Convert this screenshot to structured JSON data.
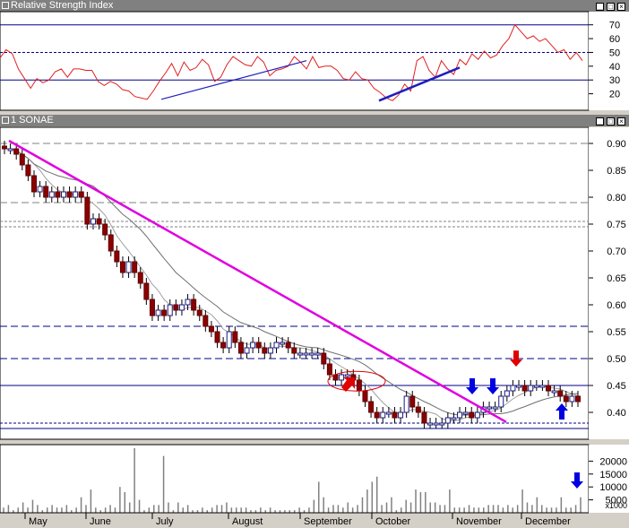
{
  "panels": {
    "rsi_title": "Relative Strength Index",
    "price_title": "1 SONAE"
  },
  "chart_data": [
    {
      "type": "line",
      "title": "Relative Strength Index",
      "ylim": [
        10,
        75
      ],
      "yticks": [
        20,
        30,
        40,
        50,
        60,
        70
      ],
      "reference_lines": [
        70,
        50,
        30
      ],
      "series": [
        {
          "values": [
            46,
            52,
            49,
            38,
            31,
            24,
            31,
            28,
            30,
            36,
            38,
            32,
            38,
            38,
            37,
            37,
            29,
            26,
            29,
            27,
            23,
            22,
            18,
            17,
            16,
            22,
            29,
            35,
            42,
            33,
            43,
            37,
            39,
            45,
            41,
            29,
            32,
            41,
            47,
            44,
            41,
            40,
            47,
            43,
            33,
            37,
            38,
            40,
            47,
            43,
            38,
            47,
            39,
            40,
            40,
            37,
            31,
            30,
            36,
            31,
            30,
            24,
            21,
            17,
            15,
            19,
            27,
            22,
            44,
            47,
            37,
            32,
            44,
            38,
            34,
            45,
            41,
            49,
            45,
            51,
            46,
            48,
            55,
            60,
            70,
            65,
            60,
            62,
            58,
            60,
            55,
            50,
            52,
            45,
            50,
            44
          ]
        }
      ]
    },
    {
      "type": "candlestick",
      "title": "1 SONAE",
      "ylim": [
        0.35,
        0.93
      ],
      "yticks": [
        0.4,
        0.45,
        0.5,
        0.55,
        0.6,
        0.65,
        0.7,
        0.75,
        0.8,
        0.85,
        0.9
      ],
      "x_months": [
        "May",
        "June",
        "July",
        "August",
        "September",
        "October",
        "November",
        "December"
      ],
      "close": [
        0.89,
        0.89,
        0.88,
        0.86,
        0.84,
        0.81,
        0.82,
        0.8,
        0.81,
        0.8,
        0.81,
        0.8,
        0.81,
        0.8,
        0.75,
        0.76,
        0.75,
        0.73,
        0.7,
        0.68,
        0.66,
        0.68,
        0.66,
        0.64,
        0.61,
        0.58,
        0.59,
        0.58,
        0.6,
        0.59,
        0.6,
        0.61,
        0.59,
        0.58,
        0.56,
        0.55,
        0.53,
        0.52,
        0.55,
        0.53,
        0.51,
        0.52,
        0.53,
        0.52,
        0.51,
        0.52,
        0.53,
        0.53,
        0.52,
        0.51,
        0.51,
        0.51,
        0.51,
        0.51,
        0.49,
        0.47,
        0.46,
        0.47,
        0.47,
        0.46,
        0.44,
        0.42,
        0.4,
        0.39,
        0.4,
        0.4,
        0.39,
        0.4,
        0.43,
        0.41,
        0.4,
        0.38,
        0.38,
        0.38,
        0.38,
        0.39,
        0.39,
        0.4,
        0.4,
        0.39,
        0.4,
        0.41,
        0.41,
        0.41,
        0.43,
        0.44,
        0.45,
        0.45,
        0.44,
        0.45,
        0.45,
        0.45,
        0.44,
        0.44,
        0.43,
        0.42,
        0.43,
        0.42
      ],
      "reference_lines": [
        0.9,
        0.79,
        0.755,
        0.745,
        0.56,
        0.5,
        0.45,
        0.38,
        0.37
      ],
      "annotations": [
        "red-up-right-arrow",
        "red-down-arrow",
        "blue-down-arrow",
        "blue-down-arrow",
        "blue-up-arrow"
      ]
    },
    {
      "type": "bar",
      "title": "",
      "ylabel": "x1000",
      "ylim": [
        0,
        25000
      ],
      "yticks": [
        5000,
        10000,
        15000,
        20000
      ],
      "values": [
        2,
        3,
        1,
        2,
        4,
        2,
        5,
        3,
        1,
        2,
        3,
        2,
        2,
        3,
        1,
        2,
        6,
        3,
        9,
        2,
        1,
        2,
        3,
        2,
        10,
        8,
        4,
        25,
        5,
        1,
        2,
        3,
        3,
        22,
        4,
        1,
        4,
        2,
        3,
        1,
        1,
        2,
        1,
        2,
        3,
        3,
        4,
        2,
        2,
        2,
        2,
        1,
        1,
        2,
        1,
        2,
        1,
        1,
        1,
        1,
        1,
        2,
        1,
        2,
        5,
        12,
        6,
        2,
        3,
        3,
        2,
        4,
        2,
        3,
        6,
        9,
        12,
        14,
        3,
        4,
        6,
        1,
        2,
        5,
        4,
        9,
        8,
        8,
        4,
        4,
        3,
        3,
        9,
        2,
        2,
        2,
        3,
        2,
        2,
        2,
        3,
        3,
        3,
        2,
        3,
        2,
        3,
        9,
        4,
        3,
        6,
        3,
        2,
        2,
        2,
        6,
        2,
        2,
        3,
        6
      ]
    }
  ],
  "volume_axis": {
    "unit_label": "x1000"
  }
}
